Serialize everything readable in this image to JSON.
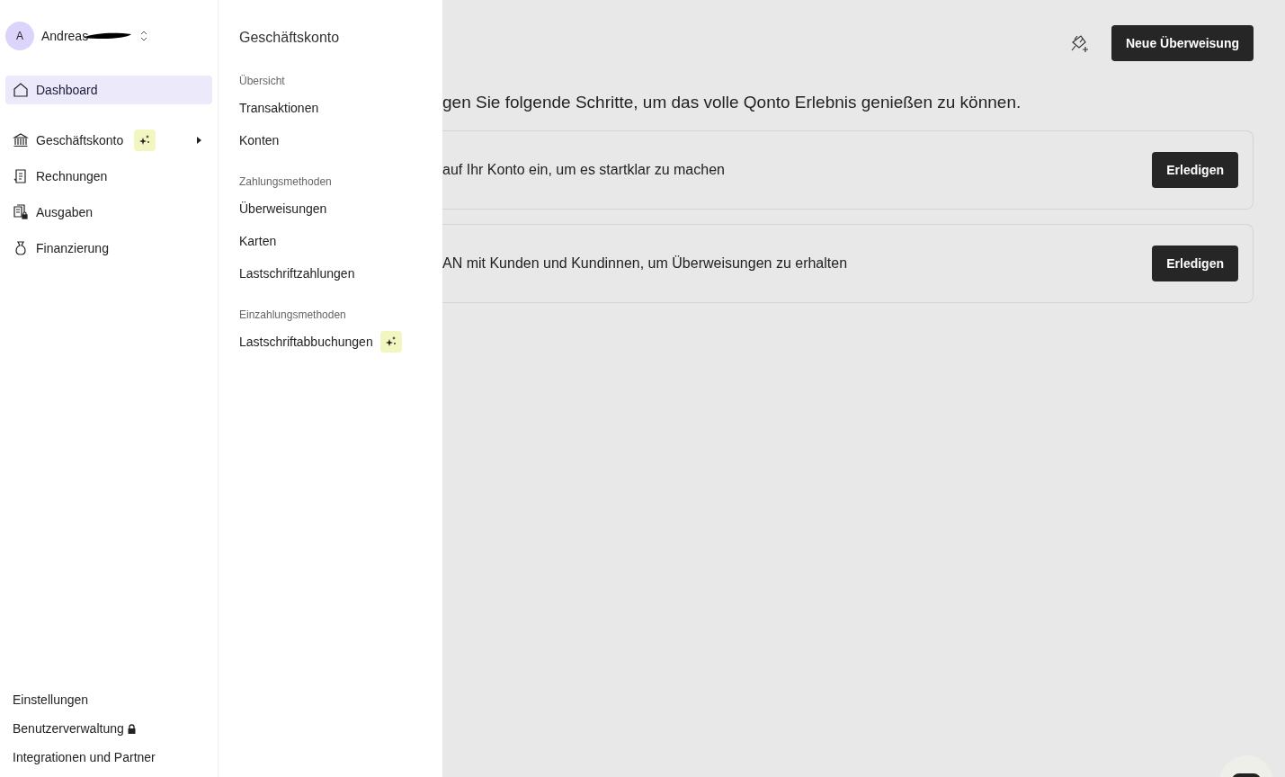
{
  "account": {
    "initial": "A",
    "name": "Andreas"
  },
  "nav": [
    {
      "label": "Dashboard",
      "kind": "home",
      "selected": true,
      "new": false,
      "expanded": false
    },
    {
      "label": "Geschäftskonto",
      "kind": "bank",
      "selected": false,
      "new": true,
      "expanded": true
    },
    {
      "label": "Rechnungen",
      "kind": "invoice",
      "selected": false,
      "new": false,
      "expanded": false
    },
    {
      "label": "Ausgaben",
      "kind": "expenses",
      "selected": false,
      "new": false,
      "expanded": false
    },
    {
      "label": "Finanzierung",
      "kind": "financing",
      "selected": false,
      "new": false,
      "expanded": false
    }
  ],
  "footer_links": [
    {
      "label": "Einstellungen",
      "locked": false
    },
    {
      "label": "Benutzerverwaltung",
      "locked": true
    },
    {
      "label": "Integrationen und Partner",
      "locked": false
    }
  ],
  "submenu": {
    "title": "Geschäftskonto",
    "sections": [
      {
        "heading": "Übersicht",
        "items": [
          {
            "label": "Transaktionen",
            "new": false
          },
          {
            "label": "Konten",
            "new": false
          }
        ]
      },
      {
        "heading": "Zahlungsmethoden",
        "items": [
          {
            "label": "Überweisungen",
            "new": false
          },
          {
            "label": "Karten",
            "new": false
          },
          {
            "label": "Lastschriftzahlungen",
            "new": false
          }
        ]
      },
      {
        "heading": "Einzahlungsmethoden",
        "items": [
          {
            "label": "Lastschriftabbuchungen",
            "new": true
          }
        ]
      }
    ]
  },
  "header": {
    "primary_button": "Neue Überweisung"
  },
  "main": {
    "heading": "gen Sie folgende Schritte, um das volle Qonto Erlebnis genießen zu können.",
    "tasks": [
      {
        "text": "auf Ihr Konto ein, um es startklar zu machen",
        "button": "Erledigen"
      },
      {
        "text": "AN mit Kunden und Kundinnen, um Überweisungen zu erhalten",
        "button": "Erledigen"
      }
    ]
  }
}
